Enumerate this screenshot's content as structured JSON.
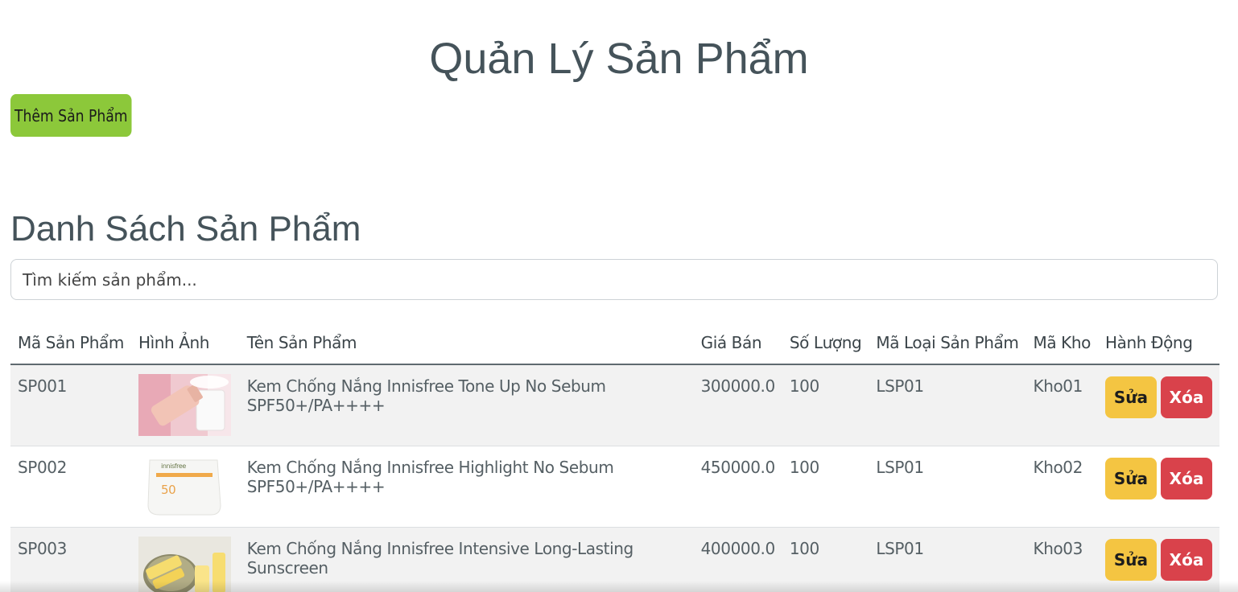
{
  "page_title": "Quản Lý Sản Phẩm",
  "add_button_label": "Thêm Sản Phẩm",
  "section_title": "Danh Sách Sản Phẩm",
  "search": {
    "placeholder": "Tìm kiếm sản phẩm...",
    "value": ""
  },
  "table": {
    "headers": [
      "Mã Sản Phẩm",
      "Hình Ảnh",
      "Tên Sản Phẩm",
      "Giá Bán",
      "Số Lượng",
      "Mã Loại Sản Phẩm",
      "Mã Kho",
      "Hành Động"
    ],
    "rows": [
      {
        "id": "SP001",
        "image": "sunscreen-tube-pink-photo",
        "name": "Kem Chống Nắng Innisfree Tone Up No Sebum SPF50+/PA++++",
        "price": "300000.0",
        "quantity": "100",
        "category": "LSP01",
        "warehouse": "Kho01",
        "edit_label": "Sửa",
        "delete_label": "Xóa"
      },
      {
        "id": "SP002",
        "image": "sunscreen-tube-white-photo",
        "name": "Kem Chống Nắng Innisfree Highlight No Sebum SPF50+/PA++++",
        "price": "450000.0",
        "quantity": "100",
        "category": "LSP01",
        "warehouse": "Kho02",
        "edit_label": "Sửa",
        "delete_label": "Xóa"
      },
      {
        "id": "SP003",
        "image": "sunscreen-tubes-yellow-photo",
        "name": "Kem Chống Nắng Innisfree Intensive Long-Lasting Sunscreen",
        "price": "400000.0",
        "quantity": "100",
        "category": "LSP01",
        "warehouse": "Kho03",
        "edit_label": "Sửa",
        "delete_label": "Xóa"
      }
    ]
  },
  "colors": {
    "title": "#45535a",
    "add_button": "#8cc83a",
    "edit_button": "#f4c542",
    "delete_button": "#d9424b",
    "striped_row": "#f2f2f2"
  }
}
